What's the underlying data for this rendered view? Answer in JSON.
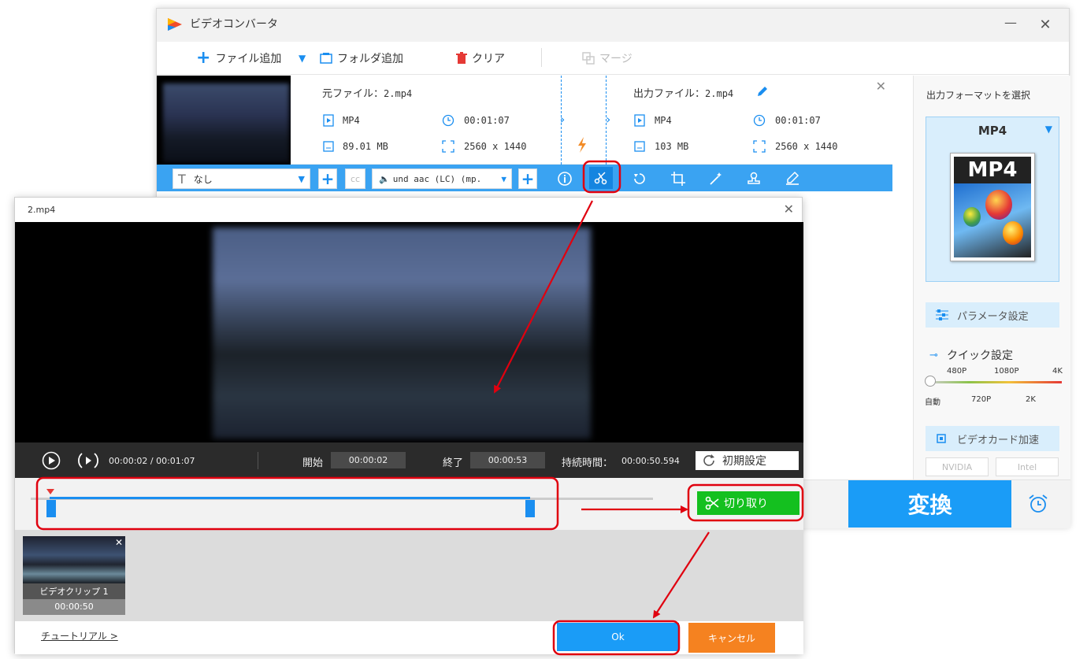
{
  "app": {
    "title": "ビデオコンバータ",
    "minimize": "—",
    "close": "✕"
  },
  "toolbar": {
    "add_file": "ファイル追加",
    "add_folder": "フォルダ追加",
    "clear": "クリア",
    "merge": "マージ"
  },
  "file": {
    "source_label": "元ファイル：",
    "source_name": "2.mp4",
    "output_label": "出力ファイル：",
    "output_name": "2.mp4",
    "src_format": "MP4",
    "src_duration": "00:01:07",
    "src_size": "89.01 MB",
    "src_resolution": "2560 x 1440",
    "out_format": "MP4",
    "out_duration": "00:01:07",
    "out_size": "103 MB",
    "out_resolution": "2560 x 1440"
  },
  "edit_bar": {
    "subtitle_value": "なし",
    "audio_value": "und aac (LC) (mp."
  },
  "format_panel": {
    "heading": "出力フォーマットを選択",
    "format_name": "MP4",
    "thumb_text": "MP4",
    "param_button": "パラメータ設定",
    "quick_label": "クイック設定",
    "quality_top": [
      "480P",
      "1080P",
      "4K"
    ],
    "quality_bottom": [
      "自動",
      "720P",
      "2K"
    ],
    "gpu_button": "ビデオカード加速",
    "nvidia": "NVIDIA",
    "intel": "Intel",
    "convert": "変換"
  },
  "dialog": {
    "title": "2.mp4",
    "current_time": "00:00:02 / 00:01:07",
    "start_label": "開始",
    "start_value": "00:00:02",
    "end_label": "終了",
    "end_value": "00:00:53",
    "duration_label": "持続時間：",
    "duration_value": "00:00:50.594",
    "reset": "初期設定",
    "cut": "切り取り",
    "clip_name": "ビデオクリップ 1",
    "clip_duration": "00:00:50",
    "tutorial": "チュートリアル >",
    "ok": "Ok",
    "cancel": "キャンセル"
  },
  "colors": {
    "accent": "#1a8ef0",
    "edit_bar": "#3aa3f2",
    "convert": "#1a9cf7",
    "cut_green": "#14c01f",
    "cancel_orange": "#f58220",
    "annotation_red": "#e0000f"
  }
}
